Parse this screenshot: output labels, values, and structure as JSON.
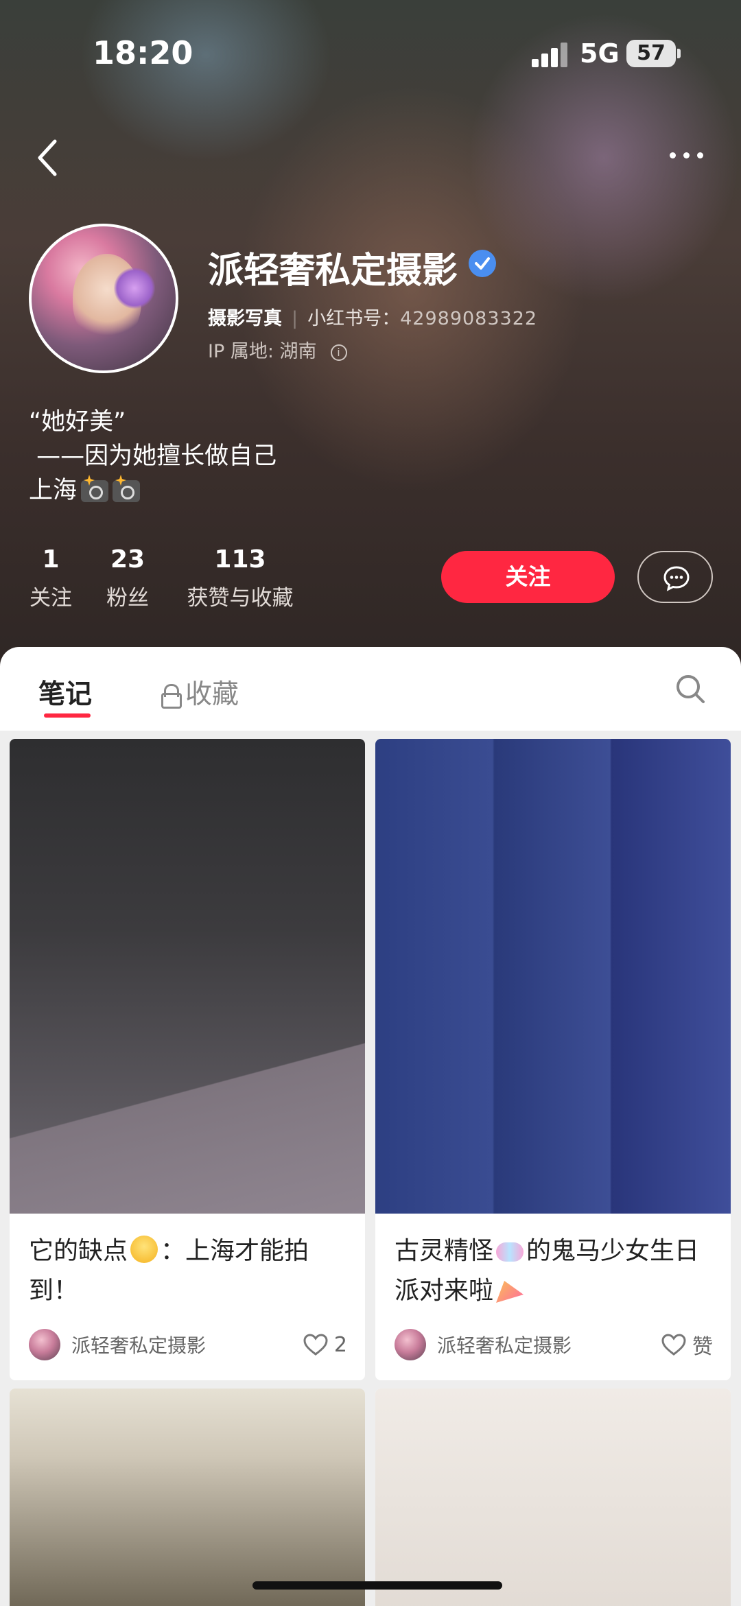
{
  "status_bar": {
    "time": "18:20",
    "network": "5G",
    "battery": "57"
  },
  "profile": {
    "name": "派轻奢私定摄影",
    "category": "摄影写真",
    "red_id_label": "小红书号：",
    "red_id": "42989083322",
    "ip_location": "IP 属地: 湖南",
    "bio": [
      "“她好美”",
      " ——因为她擅长做自己",
      "上海"
    ]
  },
  "stats": [
    {
      "value": "1",
      "label": "关注"
    },
    {
      "value": "23",
      "label": "粉丝"
    },
    {
      "value": "113",
      "label": "获赞与收藏"
    }
  ],
  "actions": {
    "follow_label": "关注"
  },
  "tabs": {
    "notes": "笔记",
    "collections": "收藏"
  },
  "notes": [
    {
      "title_a": "它的缺点",
      "title_b": "：上海才能拍到！",
      "author": "派轻奢私定摄影",
      "likes": "2"
    },
    {
      "title_a": "古灵精怪",
      "title_b": "的鬼马少女生日派对来啦",
      "author": "派轻奢私定摄影",
      "likes": "赞"
    }
  ],
  "colors": {
    "accent": "#ff2741",
    "verified": "#4a8ef0"
  }
}
